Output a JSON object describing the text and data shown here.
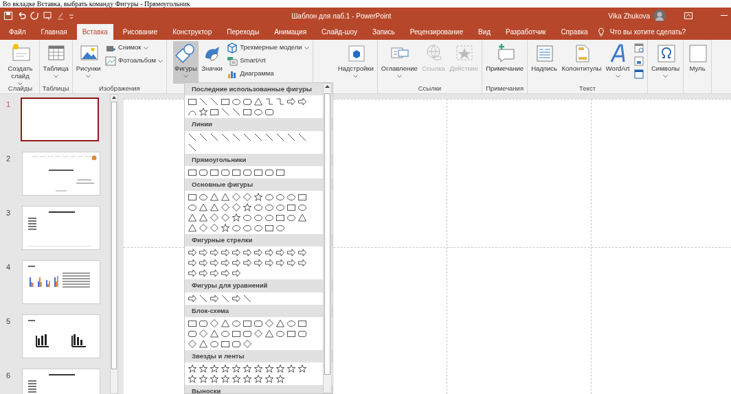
{
  "caption": "Во вкладке Вставка, выбрать команду Фигуры - Прямоугольник",
  "title_bar": {
    "title": "Шаблон для лаб.1  -  PowerPoint",
    "user": "Vika Zhukova"
  },
  "tabs": [
    {
      "label": "Файл",
      "selected": false
    },
    {
      "label": "Главная",
      "selected": false
    },
    {
      "label": "Вставка",
      "selected": true
    },
    {
      "label": "Рисование",
      "selected": false
    },
    {
      "label": "Конструктор",
      "selected": false
    },
    {
      "label": "Переходы",
      "selected": false
    },
    {
      "label": "Анимация",
      "selected": false
    },
    {
      "label": "Слайд-шоу",
      "selected": false
    },
    {
      "label": "Запись",
      "selected": false
    },
    {
      "label": "Рецензирование",
      "selected": false
    },
    {
      "label": "Вид",
      "selected": false
    },
    {
      "label": "Разработчик",
      "selected": false
    },
    {
      "label": "Справка",
      "selected": false
    }
  ],
  "search": {
    "placeholder": "Что вы хотите сделать?"
  },
  "ribbon_groups": [
    {
      "label": "Слайды",
      "buttons": [
        {
          "kind": "large",
          "label": "Создать слайд",
          "dropdown": true,
          "disabled": false,
          "selected": false
        }
      ]
    },
    {
      "label": "Таблицы",
      "buttons": [
        {
          "kind": "large",
          "label": "Таблица",
          "dropdown": true,
          "disabled": false,
          "selected": false
        }
      ]
    },
    {
      "label": "Изображения",
      "buttons": [
        {
          "kind": "large",
          "label": "Рисунки",
          "dropdown": true,
          "disabled": false,
          "selected": false
        },
        {
          "kind": "small",
          "label": "Снимок",
          "dropdown": true,
          "disabled": false,
          "selected": false
        },
        {
          "kind": "small",
          "label": "Фотоальбом",
          "dropdown": true,
          "disabled": false,
          "selected": false
        }
      ]
    },
    {
      "buttons": [
        {
          "kind": "large",
          "label": "Фигуры",
          "dropdown": true,
          "disabled": false,
          "selected": true
        },
        {
          "kind": "large",
          "label": "Значки",
          "dropdown": false,
          "disabled": false,
          "selected": false
        },
        {
          "kind": "small",
          "label": "Трехмерные модели",
          "dropdown": true,
          "disabled": false,
          "selected": false
        },
        {
          "kind": "small",
          "label": "SmartArt",
          "dropdown": false,
          "disabled": false,
          "selected": false
        },
        {
          "kind": "small",
          "label": "Диаграмма",
          "dropdown": false,
          "disabled": false,
          "selected": false
        }
      ]
    },
    {
      "buttons": [
        {
          "kind": "large",
          "label": "Надстройки",
          "dropdown": true,
          "disabled": false,
          "selected": false
        }
      ]
    },
    {
      "label": "Ссылки",
      "buttons": [
        {
          "kind": "large",
          "label": "Оглавление",
          "dropdown": true,
          "disabled": false,
          "selected": false
        },
        {
          "kind": "large",
          "label": "Ссылка",
          "dropdown": false,
          "disabled": true,
          "selected": false
        },
        {
          "kind": "large",
          "label": "Действие",
          "dropdown": false,
          "disabled": true,
          "selected": false
        }
      ]
    },
    {
      "label": "Примечания",
      "buttons": [
        {
          "kind": "large",
          "label": "Примечание",
          "dropdown": false,
          "disabled": false,
          "selected": false
        }
      ]
    },
    {
      "label": "Текст",
      "buttons": [
        {
          "kind": "large",
          "label": "Надпись",
          "dropdown": false,
          "disabled": false,
          "selected": false
        },
        {
          "kind": "large",
          "label": "Колонтитулы",
          "dropdown": false,
          "disabled": false,
          "selected": false
        },
        {
          "kind": "large",
          "label": "WordArt",
          "dropdown": true,
          "disabled": false,
          "selected": false
        },
        {
          "kind": "icon",
          "dropdown": false,
          "disabled": false,
          "selected": false
        },
        {
          "kind": "icon",
          "dropdown": false,
          "disabled": false,
          "selected": false
        },
        {
          "kind": "icon",
          "dropdown": false,
          "disabled": false,
          "selected": false
        }
      ]
    },
    {
      "buttons": [
        {
          "kind": "large",
          "label": "Символы",
          "dropdown": true,
          "disabled": false,
          "selected": false
        }
      ]
    },
    {
      "buttons": [
        {
          "kind": "large",
          "label": "Муль",
          "dropdown": false,
          "disabled": false,
          "selected": false
        }
      ]
    }
  ],
  "slides": [
    {
      "number": "1",
      "selected": true,
      "kind": "blank"
    },
    {
      "number": "2",
      "selected": false,
      "kind": "title"
    },
    {
      "number": "3",
      "selected": false,
      "kind": "list"
    },
    {
      "number": "4",
      "selected": false,
      "kind": "chart"
    },
    {
      "number": "5",
      "selected": false,
      "kind": "icons"
    },
    {
      "number": "6",
      "selected": false,
      "kind": "list"
    }
  ],
  "shapes_menu": {
    "sections": [
      {
        "title": "Последние использованные фигуры"
      },
      {
        "title": "Линии"
      },
      {
        "title": "Прямоугольники"
      },
      {
        "title": "Основные фигуры"
      },
      {
        "title": "Фигурные стрелки"
      },
      {
        "title": "Фигуры для уравнений"
      },
      {
        "title": "Блок-схема"
      },
      {
        "title": "Звезды и ленты"
      },
      {
        "title": "Выноски"
      }
    ]
  }
}
